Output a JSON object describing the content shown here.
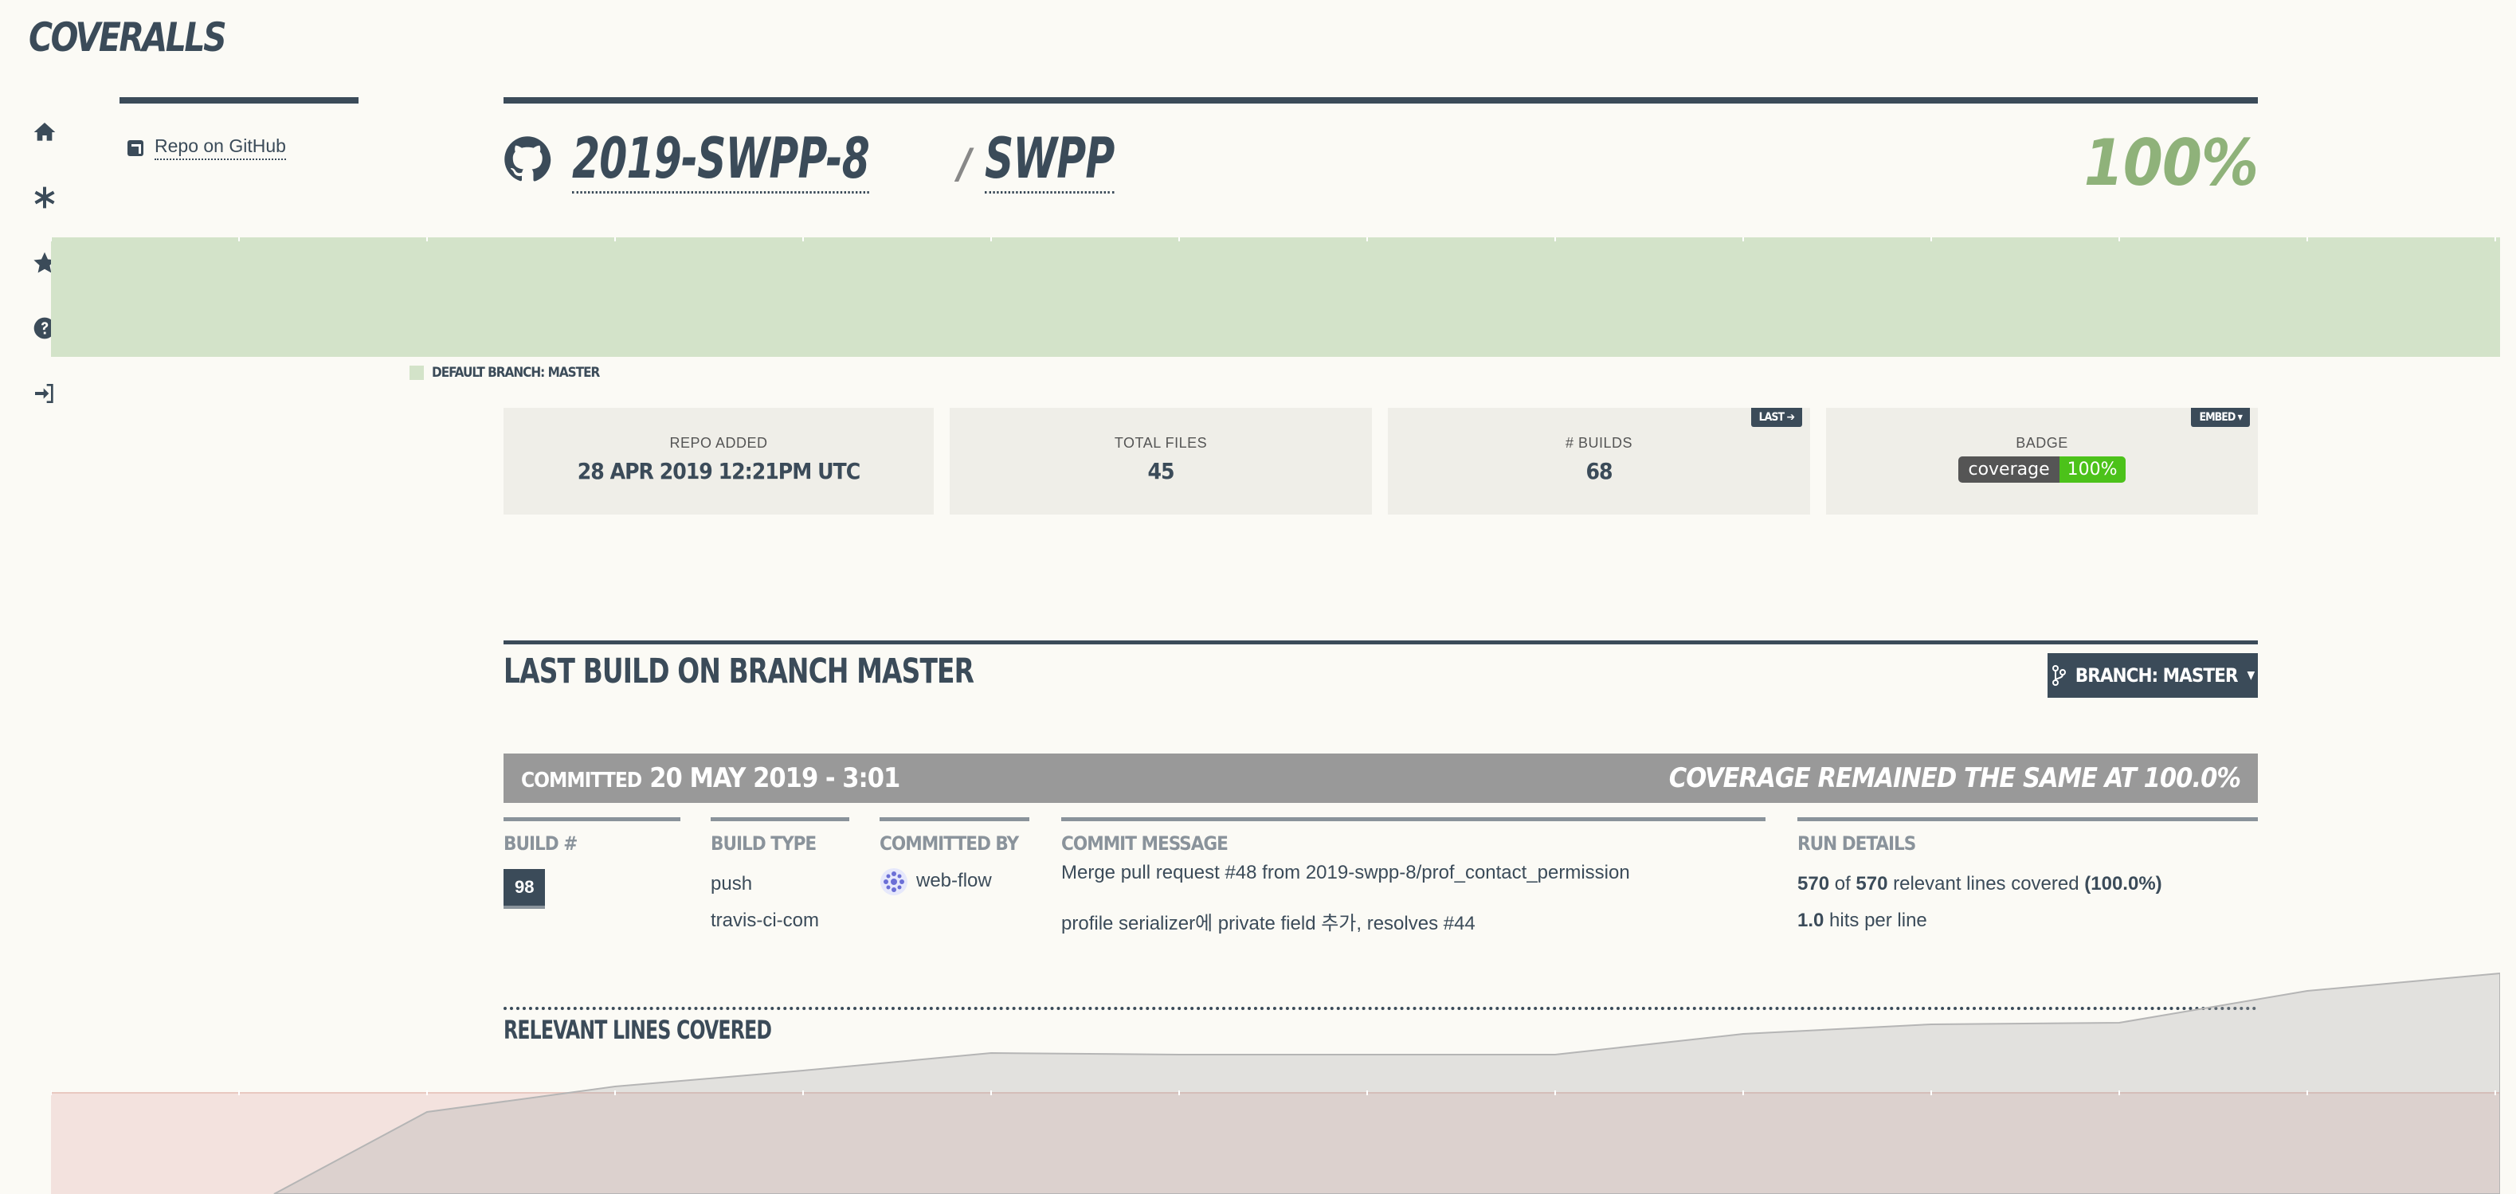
{
  "app": {
    "logo": "COVERALLS"
  },
  "nav": {
    "items": [
      {
        "icon": "home-icon"
      },
      {
        "icon": "asterisk-icon"
      },
      {
        "icon": "star-icon"
      },
      {
        "icon": "help-icon"
      },
      {
        "icon": "sign-in-icon"
      }
    ]
  },
  "sidebar": {
    "repo_link": "Repo on GitHub"
  },
  "header": {
    "owner": "2019-SWPP-8",
    "separator": "/",
    "repo": "SWPP",
    "coverage": "100%"
  },
  "legend": {
    "label": "DEFAULT BRANCH: MASTER",
    "color": "#d3e3c9"
  },
  "stats": {
    "repo_added": {
      "label": "REPO ADDED",
      "value": "28 APR 2019 12:21PM UTC"
    },
    "total_files": {
      "label": "TOTAL FILES",
      "value": "45"
    },
    "builds": {
      "label": "# BUILDS",
      "value": "68",
      "tag": "LAST"
    },
    "badge": {
      "label": "BADGE",
      "tag": "EMBED",
      "left": "coverage",
      "right": "100%"
    }
  },
  "last_build": {
    "title": "LAST BUILD ON BRANCH MASTER",
    "branch_button": "BRANCH: MASTER",
    "committed_prefix": "COMMITTED",
    "committed_date": "20 MAY 2019 - 3:01",
    "coverage_status": "COVERAGE REMAINED THE SAME AT 100.0%",
    "columns": {
      "build_num": {
        "header": "BUILD #",
        "value": "98"
      },
      "build_type": {
        "header": "BUILD TYPE",
        "line1": "push",
        "line2": "travis-ci-com"
      },
      "committed_by": {
        "header": "COMMITTED BY",
        "value": "web-flow"
      },
      "commit_message": {
        "header": "COMMIT MESSAGE",
        "line1": "Merge pull request #48 from 2019-swpp-8/prof_contact_permission",
        "line2": "profile serializer에 private field 추가, resolves #44"
      },
      "run_details": {
        "header": "RUN DETAILS",
        "covered": "570",
        "of": "of",
        "relevant": "570",
        "relevant_suffix": "relevant lines covered",
        "percent": "(100.0%)",
        "hits": "1.0",
        "hits_suffix": "hits per line"
      }
    }
  },
  "relevant_lines": {
    "title": "RELEVANT LINES COVERED"
  },
  "colors": {
    "brand": "#3b4b59",
    "coverage_green": "#8fb27a",
    "badge_green": "#4cc21a",
    "top_band": "#d3e3c9",
    "bottom_band": "#f3e2de"
  }
}
